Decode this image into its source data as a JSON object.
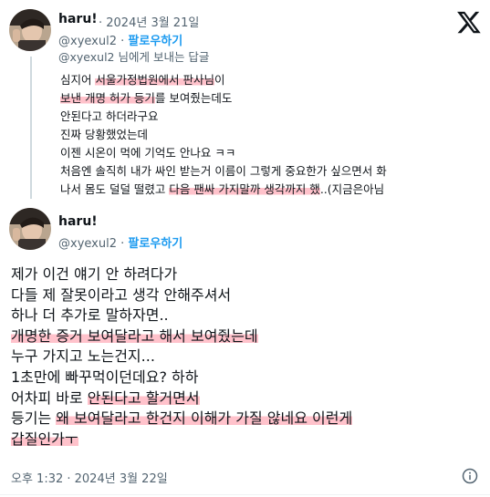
{
  "colors": {
    "accent": "#1d9bf0",
    "muted": "#536471",
    "text": "#0f1419",
    "highlight": "#ff788c"
  },
  "quoted_tweet": {
    "name": "haru!",
    "date": "· 2024년 3월 21일",
    "handle": "@xyexul2",
    "separator": "·",
    "follow": "팔로우하기",
    "reply_to": "@xyexul2 님에게 보내는 답글",
    "lines": [
      {
        "parts": [
          {
            "t": "심지어 ",
            "h": false
          },
          {
            "t": "서울가정법원에서 판사님",
            "h": true
          },
          {
            "t": "이",
            "h": false
          }
        ]
      },
      {
        "parts": [
          {
            "t": "보낸 개명 허가 등기",
            "h": true
          },
          {
            "t": "를 보여줬는데도",
            "h": false
          }
        ]
      },
      {
        "parts": [
          {
            "t": "안된다고 하더라구요",
            "h": false
          }
        ]
      },
      {
        "parts": [
          {
            "t": "진짜 당황했었는데",
            "h": false
          }
        ]
      },
      {
        "parts": [
          {
            "t": "이젠 시온이 먹에 기억도 안나요 ㅋㅋ",
            "h": false
          }
        ]
      },
      {
        "parts": [
          {
            "t": "처음엔 솔직히 내가 싸인 받는거 이름이 그렇게 중요한가 싶으면서 화",
            "h": false
          }
        ]
      },
      {
        "parts": [
          {
            "t": "나서 몸도 덜덜 떨렸고 ",
            "h": false
          },
          {
            "t": "다음 팬싸 가지말까 생각까지 했",
            "h": true
          },
          {
            "t": "..(지금은아님",
            "h": false
          }
        ]
      }
    ]
  },
  "main_tweet": {
    "name": "haru!",
    "handle": "@xyexul2",
    "separator": "·",
    "follow": "팔로우하기",
    "lines": [
      {
        "parts": [
          {
            "t": "제가 이건 얘기 안 하려다가",
            "h": false
          }
        ]
      },
      {
        "parts": [
          {
            "t": "다들 제 잘못이라고 생각 안해주셔서",
            "h": false
          }
        ]
      },
      {
        "parts": [
          {
            "t": "하나 더 추가로 말하자면..",
            "h": false
          }
        ]
      },
      {
        "parts": [
          {
            "t": "개명한 증거 보여달라고 해서 보여줬는데",
            "h": true
          }
        ]
      },
      {
        "parts": [
          {
            "t": "누구 가지고 노는건지...",
            "h": false
          }
        ]
      },
      {
        "parts": [
          {
            "t": "1초만에 빠꾸먹이던데요? 하하",
            "h": false
          }
        ]
      },
      {
        "parts": [
          {
            "t": "어차피 바로 ",
            "h": false
          },
          {
            "t": "안된다고 할거면서",
            "h": true
          }
        ]
      },
      {
        "parts": [
          {
            "t": "등기는 ",
            "h": false
          },
          {
            "t": "왜 보여달라고 한건지 이해가 가질 않네요 이런게",
            "h": true
          }
        ]
      },
      {
        "parts": [
          {
            "t": "갑질인가ㅜ",
            "h": true
          }
        ]
      }
    ],
    "timestamp": "오후 1:32 · 2024년 3월 22일"
  },
  "icons": {
    "logo": "x-logo-icon",
    "info": "info-icon"
  }
}
